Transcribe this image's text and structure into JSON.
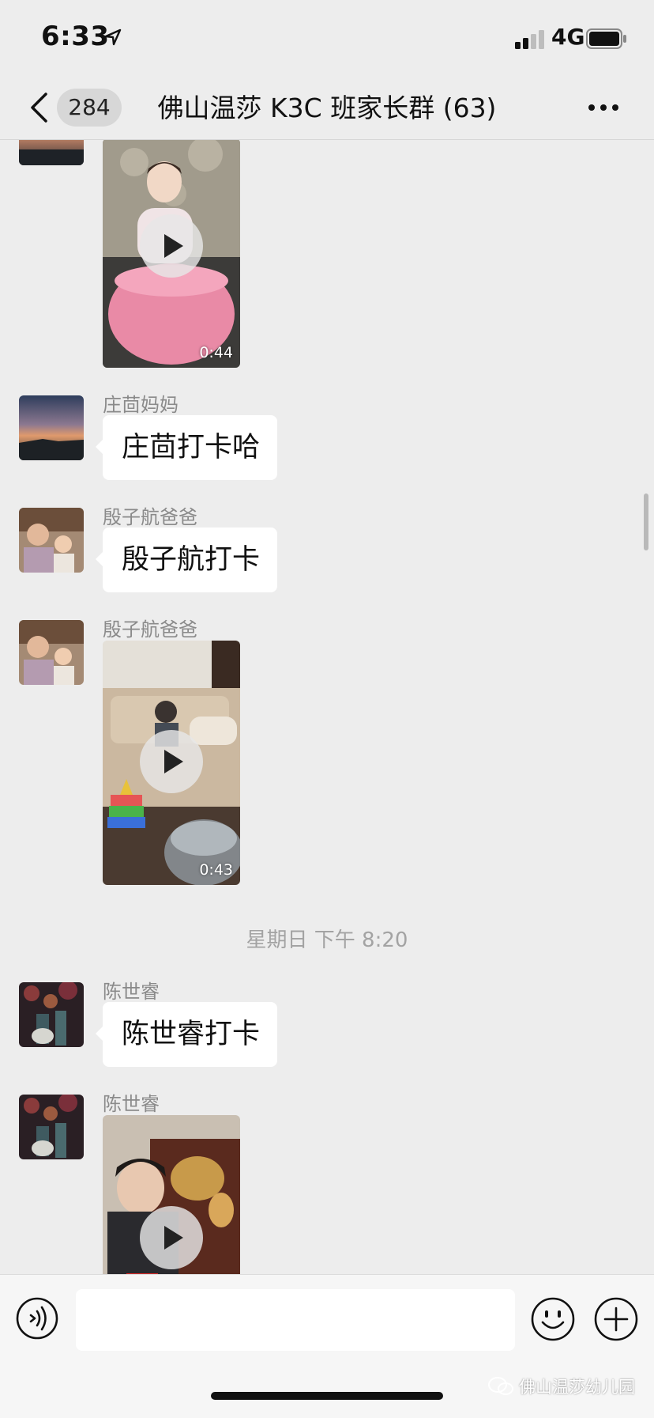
{
  "status_bar": {
    "time": "6:33",
    "network": "4G"
  },
  "nav": {
    "unread_count": "284",
    "title": "佛山温莎 K3C 班家长群 (63)"
  },
  "messages": [
    {
      "type": "video",
      "duration": "0:44"
    },
    {
      "type": "text",
      "sender": "庄茴妈妈",
      "text": "庄茴打卡哈"
    },
    {
      "type": "text",
      "sender": "殷子航爸爸",
      "text": "殷子航打卡"
    },
    {
      "type": "video",
      "sender": "殷子航爸爸",
      "duration": "0:43"
    },
    {
      "type": "timestamp",
      "text": "星期日 下午 8:20"
    },
    {
      "type": "text",
      "sender": "陈世睿",
      "text": "陈世睿打卡"
    },
    {
      "type": "video",
      "sender": "陈世睿"
    }
  ],
  "input_bar": {
    "placeholder": ""
  },
  "watermark": "佛山温莎幼儿园",
  "colors": {
    "background": "#ededed",
    "bubble": "#ffffff",
    "sender_text": "#8a8a8a"
  },
  "icons": [
    "location-arrow-icon",
    "signal-icon",
    "battery-icon",
    "back-chevron-icon",
    "more-dots-icon",
    "play-icon",
    "voice-icon",
    "emoji-icon",
    "plus-icon",
    "wechat-logo-icon"
  ]
}
